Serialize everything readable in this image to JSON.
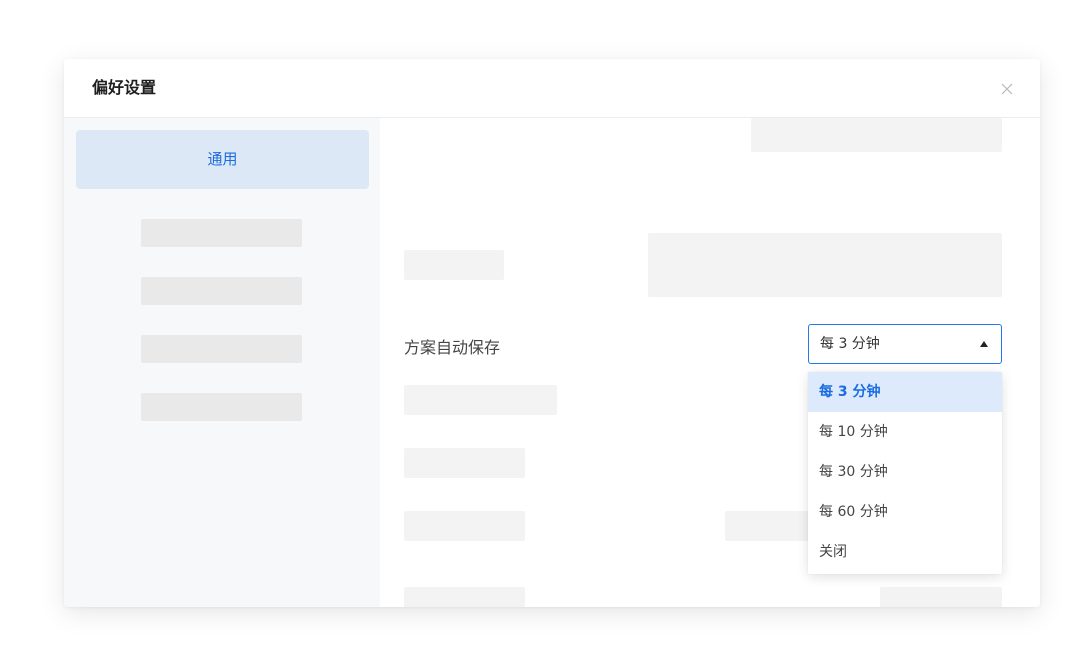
{
  "dialog": {
    "title": "偏好设置",
    "close_icon": "close-icon"
  },
  "sidebar": {
    "active_item": "通用"
  },
  "main": {
    "autosave_label": "方案自动保存",
    "autosave_select": {
      "value": "每 3 分钟",
      "options": [
        "每 3 分钟",
        "每 10 分钟",
        "每 30 分钟",
        "每 60 分钟",
        "关闭"
      ],
      "selected_index": 0
    }
  },
  "colors": {
    "accent": "#1a6ce0",
    "active_nav_bg": "#dde8f7",
    "selected_option_bg": "#ddeafb",
    "sidebar_bg": "#f7f8fa",
    "placeholder": "#f3f3f3"
  }
}
